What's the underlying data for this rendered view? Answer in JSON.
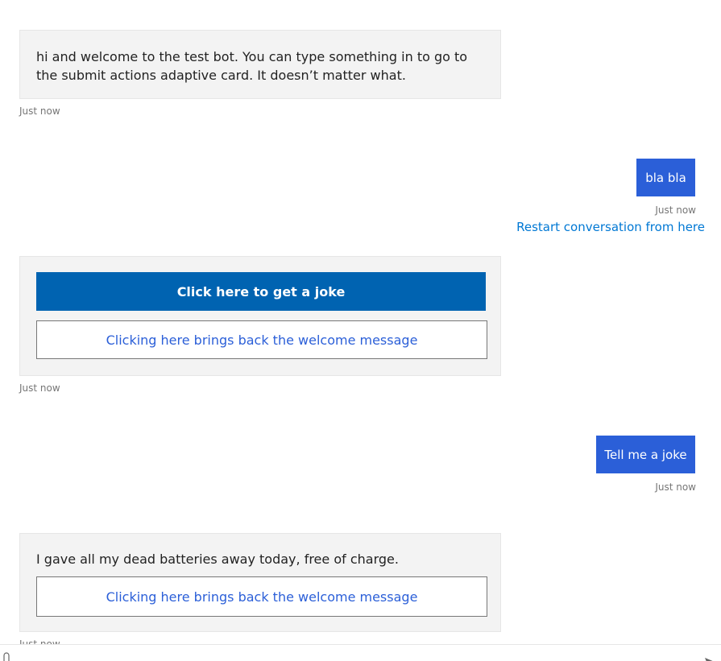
{
  "transcript": {
    "messages": [
      {
        "from": "bot",
        "text": "hi and welcome to the test bot. You can type something in to go to the submit actions adaptive card. It doesn’t matter what.",
        "timestamp": "Just now"
      },
      {
        "from": "user",
        "text": "bla bla",
        "timestamp": "Just now",
        "restart_link": "Restart conversation from here"
      },
      {
        "from": "bot",
        "card": {
          "primary_action": "Click here to get a joke",
          "secondary_action": "Clicking here brings back the welcome message"
        },
        "timestamp": "Just now"
      },
      {
        "from": "user",
        "text": "Tell me a joke",
        "timestamp": "Just now"
      },
      {
        "from": "bot",
        "text": "I gave all my dead batteries away today, free of charge.",
        "card": {
          "secondary_action": "Clicking here brings back the welcome message"
        },
        "timestamp": "Just now"
      }
    ]
  },
  "input": {
    "upload_icon": "paperclip-icon",
    "send_icon": "send-icon"
  },
  "colors": {
    "user_bubble": "#2b5fd8",
    "bot_bubble": "#f3f3f3",
    "primary_button": "#0063b1",
    "link": "#0078d4"
  }
}
